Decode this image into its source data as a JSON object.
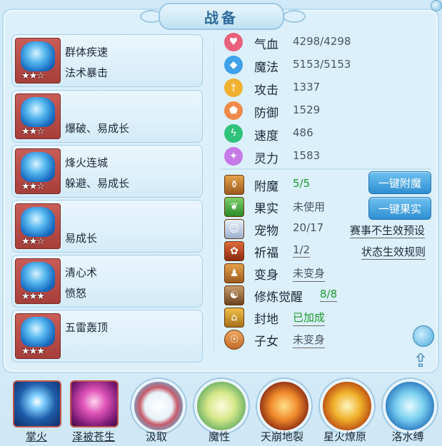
{
  "header": {
    "title": "战备"
  },
  "equipment": [
    {
      "line1": "群体疾速",
      "line2": "法术暴击",
      "stars": "★★☆"
    },
    {
      "line1": "",
      "line2": "爆破、易成长",
      "stars": "★★☆"
    },
    {
      "line1": "烽火连城",
      "line2": "躲避、易成长",
      "stars": "★★☆"
    },
    {
      "line1": "",
      "line2": "易成长",
      "stars": "★★☆"
    },
    {
      "line1": "清心术",
      "line2": "愤怒",
      "stars": "★★★"
    },
    {
      "line1": "五雷轰顶",
      "line2": "",
      "stars": "★★★"
    }
  ],
  "stats": [
    {
      "name": "气血",
      "value": "4298/4298",
      "icon": "heart-icon",
      "color": "#e8607a"
    },
    {
      "name": "魔法",
      "value": "5153/5153",
      "icon": "mana-icon",
      "color": "#3ea1ea"
    },
    {
      "name": "攻击",
      "value": "1337",
      "icon": "sword-icon",
      "color": "#f0b030"
    },
    {
      "name": "防御",
      "value": "1529",
      "icon": "shield-icon",
      "color": "#f08a4a"
    },
    {
      "name": "速度",
      "value": "486",
      "icon": "speed-icon",
      "color": "#2fc27a"
    },
    {
      "name": "灵力",
      "value": "1583",
      "icon": "spirit-icon",
      "color": "#c67ae8"
    }
  ],
  "props": [
    {
      "name": "附魔",
      "value": "5/5",
      "icon": "enchant-icon"
    },
    {
      "name": "果实",
      "value": "未使用",
      "icon": "fruit-icon"
    },
    {
      "name": "宠物",
      "value": "20/17",
      "icon": "pet-icon"
    },
    {
      "name": "祈福",
      "value": "1/2",
      "icon": "blessing-icon"
    },
    {
      "name": "变身",
      "value": "未变身",
      "icon": "transform-icon"
    },
    {
      "name": "修炼觉醒",
      "value": "8/8",
      "icon": "cultivation-icon"
    },
    {
      "name": "封地",
      "value": "已加成",
      "icon": "fief-icon"
    },
    {
      "name": "子女",
      "value": "未变身",
      "icon": "children-icon"
    }
  ],
  "buttons": {
    "enchant": "一键附魔",
    "fruit": "一键果实"
  },
  "links": {
    "match": "赛事不生效预设",
    "status": "状态生效规则"
  },
  "skills": [
    {
      "label": "掌火",
      "underline": true
    },
    {
      "label": "泽被苍生",
      "underline": true
    },
    {
      "label": "汲取",
      "underline": false
    },
    {
      "label": "魔性",
      "underline": false
    },
    {
      "label": "天崩地裂",
      "underline": false
    },
    {
      "label": "星火燎原",
      "underline": false
    },
    {
      "label": "洛水缚",
      "underline": false
    }
  ]
}
